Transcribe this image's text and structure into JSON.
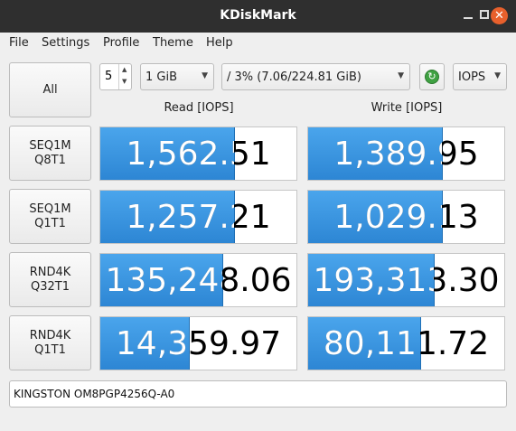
{
  "window": {
    "title": "KDiskMark"
  },
  "menu": [
    "File",
    "Settings",
    "Profile",
    "Theme",
    "Help"
  ],
  "toolbar": {
    "all_label": "All",
    "runs": "5",
    "size": "1 GiB",
    "target": "/ 3% (7.06/224.81 GiB)",
    "unit": "IOPS"
  },
  "headers": {
    "read": "Read [IOPS]",
    "write": "Write [IOPS]"
  },
  "tests": [
    {
      "name": "SEQ1M",
      "params": "Q8T1",
      "read": "1,562.51",
      "write": "1,389.95",
      "read_fill": 0.68,
      "write_fill": 0.68
    },
    {
      "name": "SEQ1M",
      "params": "Q1T1",
      "read": "1,257.21",
      "write": "1,029.13",
      "read_fill": 0.68,
      "write_fill": 0.68
    },
    {
      "name": "RND4K",
      "params": "Q32T1",
      "read": "135,248.06",
      "write": "193,313.30",
      "read_fill": 0.62,
      "write_fill": 0.64
    },
    {
      "name": "RND4K",
      "params": "Q1T1",
      "read": "14,359.97",
      "write": "80,111.72",
      "read_fill": 0.45,
      "write_fill": 0.57
    }
  ],
  "device": "KINGSTON OM8PGP4256Q-A0",
  "colors": {
    "bar": "#2d86d4",
    "titlebar": "#2f2f2f",
    "close": "#e8602c"
  }
}
